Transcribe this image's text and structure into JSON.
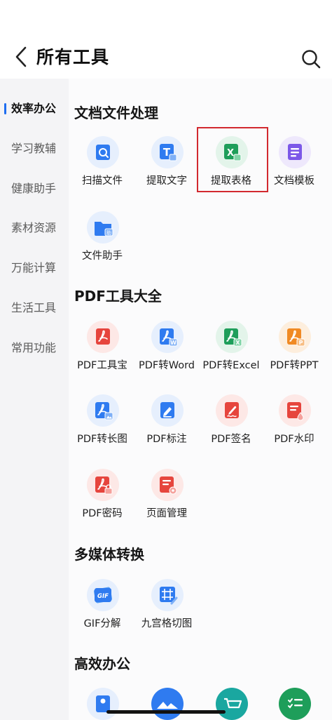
{
  "header": {
    "title": "所有工具"
  },
  "sidebar": {
    "items": [
      {
        "label": "效率办公",
        "active": true
      },
      {
        "label": "学习教辅"
      },
      {
        "label": "健康助手"
      },
      {
        "label": "素材资源"
      },
      {
        "label": "万能计算"
      },
      {
        "label": "生活工具"
      },
      {
        "label": "常用功能"
      }
    ]
  },
  "sections": [
    {
      "title": "文档文件处理",
      "tools": [
        {
          "label": "扫描文件",
          "icon": "scan-icon",
          "color": "#2f7bf0"
        },
        {
          "label": "提取文字",
          "icon": "extract-text-icon",
          "color": "#2f7bf0"
        },
        {
          "label": "提取表格",
          "icon": "excel-icon",
          "color": "#1e9e5a",
          "highlighted": true
        },
        {
          "label": "文档模板",
          "icon": "template-icon",
          "color": "#7c58e8"
        },
        {
          "label": "文件助手",
          "icon": "folder-icon",
          "color": "#2f7bf0"
        }
      ]
    },
    {
      "title": "PDF工具大全",
      "tools": [
        {
          "label": "PDF工具宝",
          "icon": "pdf-icon",
          "color": "#e6453d"
        },
        {
          "label": "PDF转Word",
          "icon": "pdf-word-icon",
          "color": "#2f7bf0"
        },
        {
          "label": "PDF转Excel",
          "icon": "pdf-excel-icon",
          "color": "#1e9e5a"
        },
        {
          "label": "PDF转PPT",
          "icon": "pdf-ppt-icon",
          "color": "#f08a24"
        },
        {
          "label": "PDF转长图",
          "icon": "pdf-image-icon",
          "color": "#2f7bf0"
        },
        {
          "label": "PDF标注",
          "icon": "pdf-annotate-icon",
          "color": "#2f7bf0"
        },
        {
          "label": "PDF签名",
          "icon": "pdf-sign-icon",
          "color": "#e6453d"
        },
        {
          "label": "PDF水印",
          "icon": "pdf-watermark-icon",
          "color": "#e6453d"
        },
        {
          "label": "PDF密码",
          "icon": "pdf-lock-icon",
          "color": "#e6453d"
        },
        {
          "label": "页面管理",
          "icon": "page-manage-icon",
          "color": "#e6453d"
        }
      ]
    },
    {
      "title": "多媒体转换",
      "tools": [
        {
          "label": "GIF分解",
          "icon": "gif-icon",
          "color": "#2f7bf0"
        },
        {
          "label": "九宫格切图",
          "icon": "grid-cut-icon",
          "color": "#2f7bf0"
        }
      ]
    },
    {
      "title": "高效办公",
      "tools": [
        {
          "label": "",
          "icon": "id-card-icon",
          "color": "#2f7bf0"
        },
        {
          "label": "",
          "icon": "mountain-icon",
          "color": "#2f7bf0"
        },
        {
          "label": "",
          "icon": "cart-icon",
          "color": "#1aa7a0"
        },
        {
          "label": "",
          "icon": "checklist-icon",
          "color": "#1e9e5a"
        }
      ]
    }
  ],
  "glyphs": {
    "excel": "X",
    "word": "W",
    "ppt": "P",
    "gif": "GIF",
    "assist": "助"
  }
}
